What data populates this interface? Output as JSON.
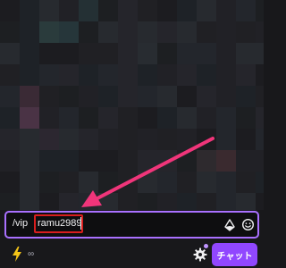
{
  "chat_input": {
    "command_text": "/vip",
    "username_text": "ramu2989"
  },
  "bottom_bar": {
    "points_label": "∞",
    "chat_button_label": "チャット"
  },
  "icons": {
    "bits": "bits-icon",
    "emote": "emote-smile-icon",
    "channel_points": "lightning-bolt-icon",
    "settings": "gear-icon"
  },
  "colors": {
    "accent_purple": "#9147ff",
    "input_border": "#a970ff",
    "highlight_red": "#d81e1e",
    "arrow_pink": "#f0357a",
    "bolt_yellow": "#f5c518",
    "background": "#18181b"
  }
}
